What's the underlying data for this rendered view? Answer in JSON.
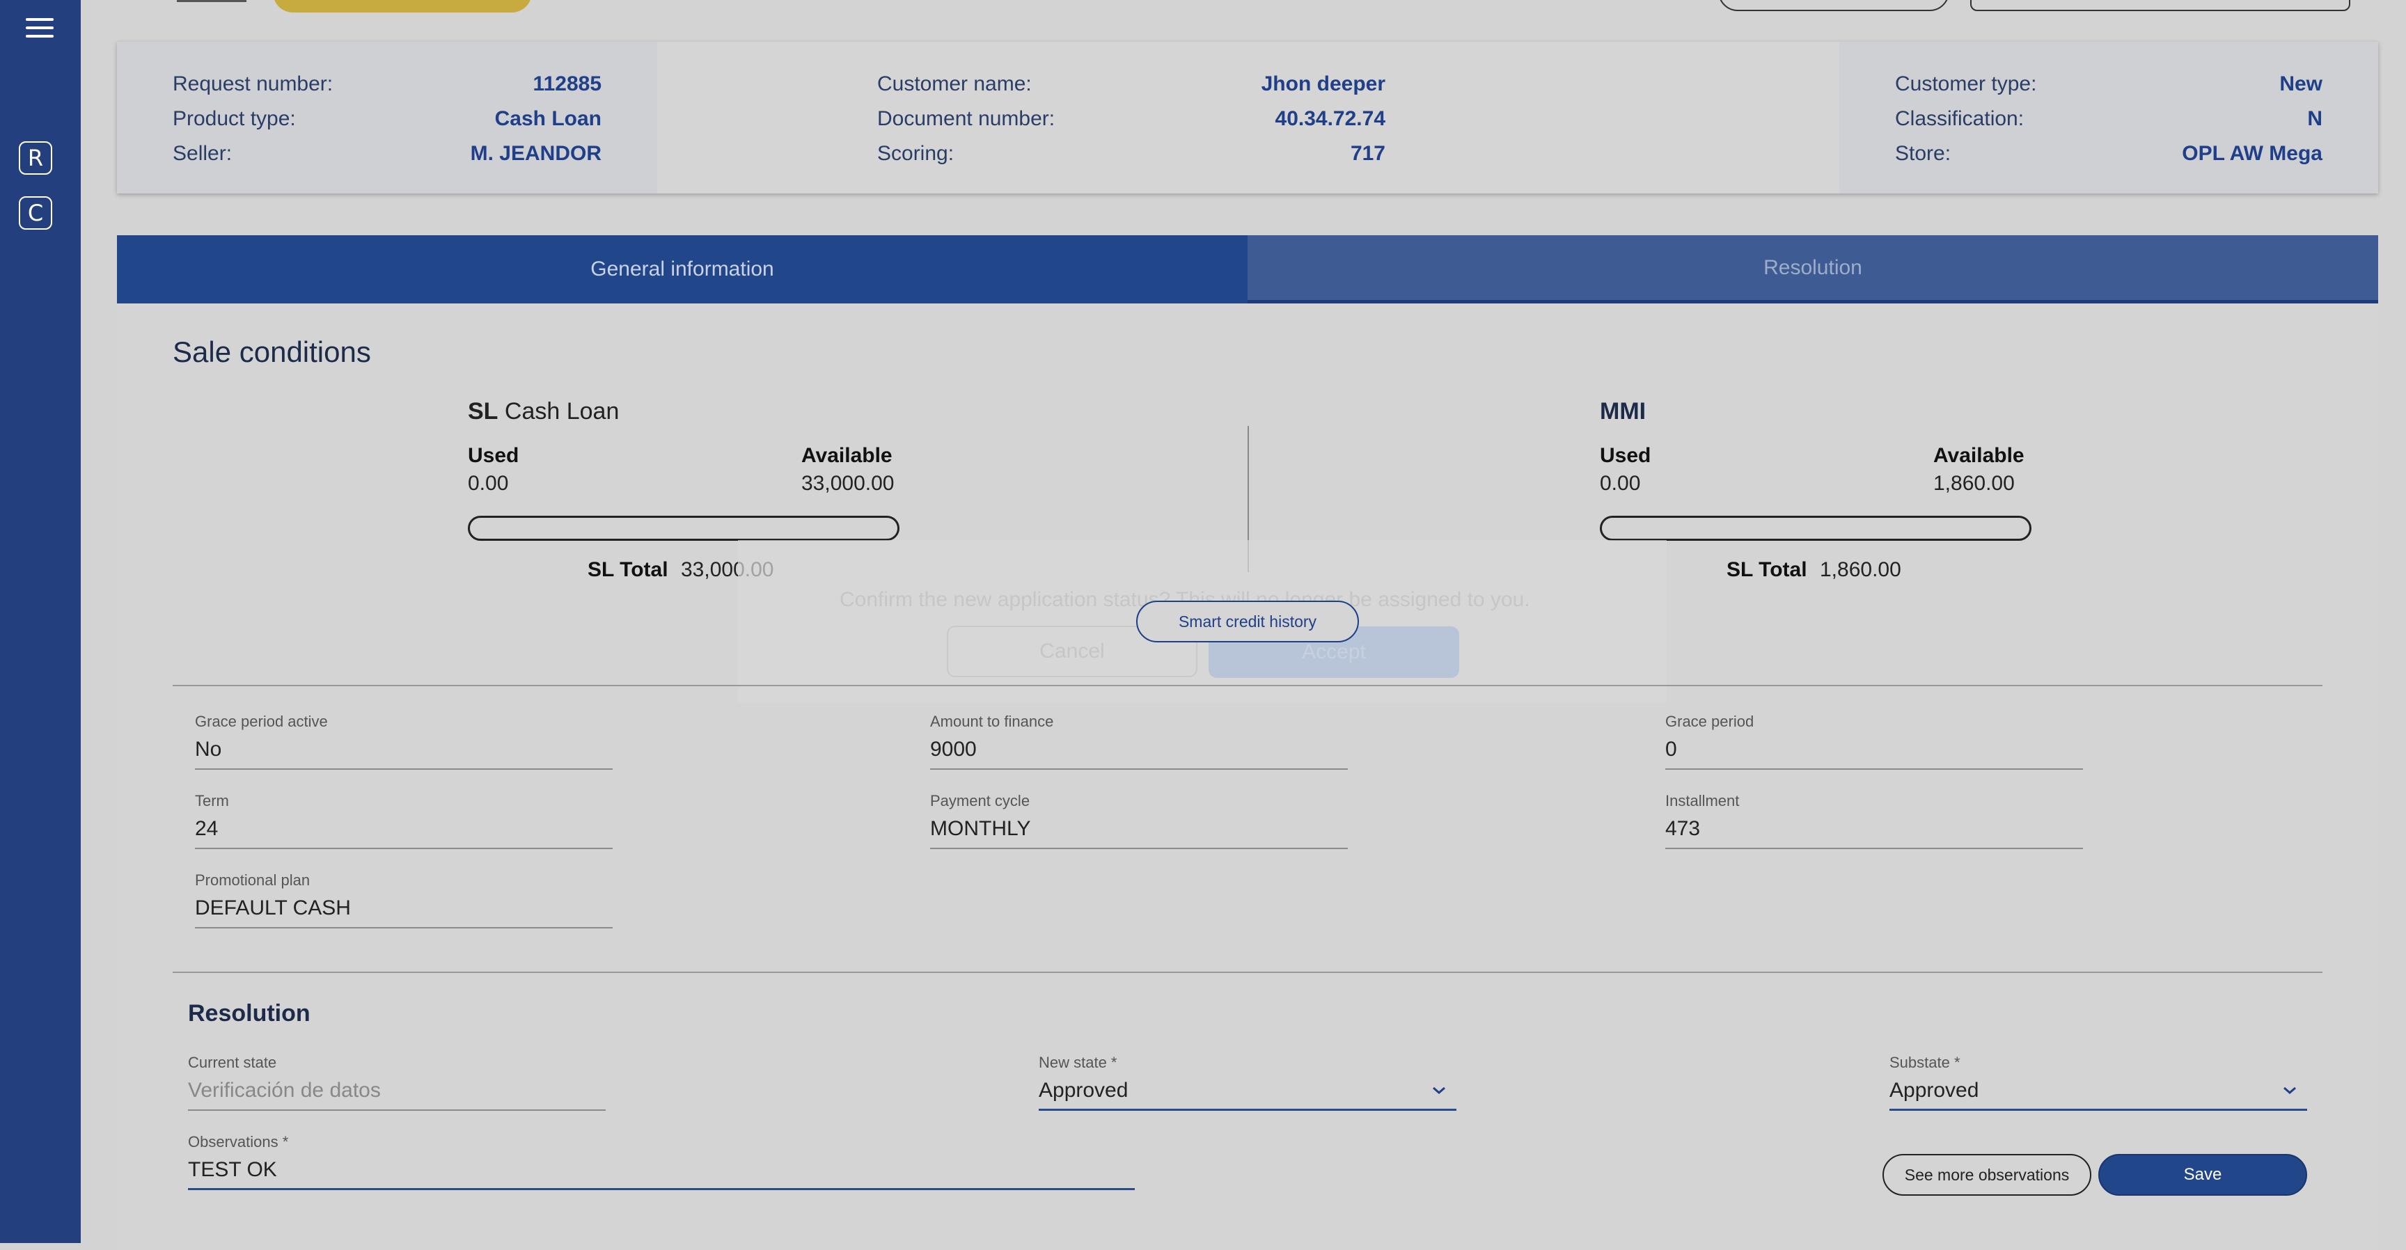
{
  "header": {
    "col1": [
      {
        "key": "Request number:",
        "value": "112885"
      },
      {
        "key": "Product type:",
        "value": "Cash Loan"
      },
      {
        "key": "Seller:",
        "value": "M. JEANDOR"
      }
    ],
    "col2": [
      {
        "key": "Customer name:",
        "value": "Jhon deeper"
      },
      {
        "key": "Document number:",
        "value": "40.34.72.74"
      },
      {
        "key": "Scoring:",
        "value": "717"
      }
    ],
    "col3": [
      {
        "key": "Customer type:",
        "value": "New"
      },
      {
        "key": "Classification:",
        "value": "N"
      },
      {
        "key": "Store:",
        "value": "OPL AW Mega"
      }
    ]
  },
  "sidebar": {
    "btn_r": "R",
    "btn_c": "C"
  },
  "tabs": {
    "general": "General information",
    "resolution": "Resolution"
  },
  "sale": {
    "title": "Sale conditions",
    "left": {
      "code": "SL",
      "name": "Cash Loan",
      "used_label": "Used",
      "used": "0.00",
      "avail_label": "Available",
      "avail": "33,000.00",
      "total_label": "SL Total",
      "total": "33,000.00",
      "used_fraction": 0
    },
    "right": {
      "name": "MMI",
      "used_label": "Used",
      "used": "0.00",
      "avail_label": "Available",
      "avail": "1,860.00",
      "total_label": "SL Total",
      "total": "1,860.00",
      "used_fraction": 0
    },
    "smart_btn": "Smart credit history"
  },
  "dialog": {
    "message": "Confirm the new application status? This will no longer be assigned to you.",
    "cancel": "Cancel",
    "accept": "Accept"
  },
  "fields": {
    "grace_active": {
      "label": "Grace period active",
      "value": "No"
    },
    "amount": {
      "label": "Amount to finance",
      "value": "9000"
    },
    "grace_period": {
      "label": "Grace period",
      "value": "0"
    },
    "term": {
      "label": "Term",
      "value": "24"
    },
    "cycle": {
      "label": "Payment cycle",
      "value": "MONTHLY"
    },
    "installment": {
      "label": "Installment",
      "value": "473"
    },
    "promo": {
      "label": "Promotional plan",
      "value": "DEFAULT CASH"
    }
  },
  "resolution": {
    "title": "Resolution",
    "current_state": {
      "label": "Current state",
      "value": "Verificación de datos"
    },
    "new_state": {
      "label": "New state *",
      "value": "Approved"
    },
    "substate": {
      "label": "Substate *",
      "value": "Approved"
    },
    "observations": {
      "label": "Observations *",
      "value": "TEST OK"
    },
    "see_more": "See more observations",
    "save": "Save"
  }
}
